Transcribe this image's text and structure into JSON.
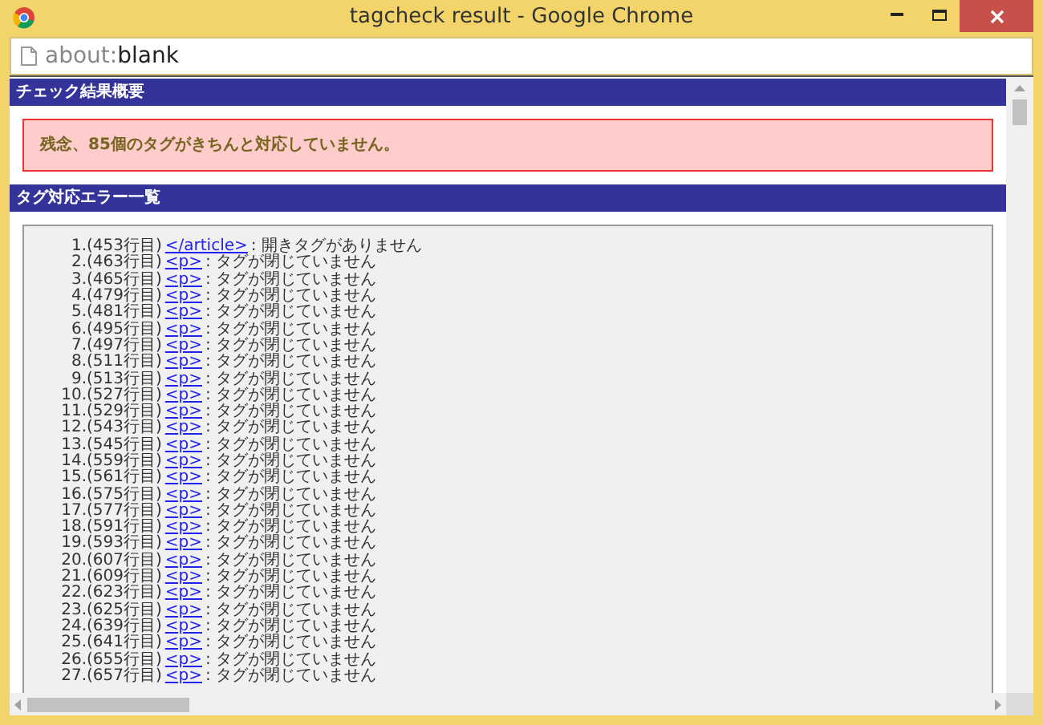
{
  "window": {
    "title": "tagcheck result - Google Chrome"
  },
  "address_bar": {
    "scheme": "about:",
    "path": "blank"
  },
  "summary": {
    "heading": "チェック結果概要",
    "message": "残念、85個のタグがきちんと対応していません。"
  },
  "errors": {
    "heading": "タグ対応エラー一覧",
    "rows": [
      {
        "number": "1.",
        "line": "(453行目)",
        "tag": "</article>",
        "message": ": 開きタグがありません"
      },
      {
        "number": "2.",
        "line": "(463行目)",
        "tag": "<p>",
        "message": ": タグが閉じていません"
      },
      {
        "number": "3.",
        "line": "(465行目)",
        "tag": "<p>",
        "message": ": タグが閉じていません"
      },
      {
        "number": "4.",
        "line": "(479行目)",
        "tag": "<p>",
        "message": ": タグが閉じていません"
      },
      {
        "number": "5.",
        "line": "(481行目)",
        "tag": "<p>",
        "message": ": タグが閉じていません"
      },
      {
        "number": "6.",
        "line": "(495行目)",
        "tag": "<p>",
        "message": ": タグが閉じていません"
      },
      {
        "number": "7.",
        "line": "(497行目)",
        "tag": "<p>",
        "message": ": タグが閉じていません"
      },
      {
        "number": "8.",
        "line": "(511行目)",
        "tag": "<p>",
        "message": ": タグが閉じていません"
      },
      {
        "number": "9.",
        "line": "(513行目)",
        "tag": "<p>",
        "message": ": タグが閉じていません"
      },
      {
        "number": "10.",
        "line": "(527行目)",
        "tag": "<p>",
        "message": ": タグが閉じていません"
      },
      {
        "number": "11.",
        "line": "(529行目)",
        "tag": "<p>",
        "message": ": タグが閉じていません"
      },
      {
        "number": "12.",
        "line": "(543行目)",
        "tag": "<p>",
        "message": ": タグが閉じていません"
      },
      {
        "number": "13.",
        "line": "(545行目)",
        "tag": "<p>",
        "message": ": タグが閉じていません"
      },
      {
        "number": "14.",
        "line": "(559行目)",
        "tag": "<p>",
        "message": ": タグが閉じていません"
      },
      {
        "number": "15.",
        "line": "(561行目)",
        "tag": "<p>",
        "message": ": タグが閉じていません"
      },
      {
        "number": "16.",
        "line": "(575行目)",
        "tag": "<p>",
        "message": ": タグが閉じていません"
      },
      {
        "number": "17.",
        "line": "(577行目)",
        "tag": "<p>",
        "message": ": タグが閉じていません"
      },
      {
        "number": "18.",
        "line": "(591行目)",
        "tag": "<p>",
        "message": ": タグが閉じていません"
      },
      {
        "number": "19.",
        "line": "(593行目)",
        "tag": "<p>",
        "message": ": タグが閉じていません"
      },
      {
        "number": "20.",
        "line": "(607行目)",
        "tag": "<p>",
        "message": ": タグが閉じていません"
      },
      {
        "number": "21.",
        "line": "(609行目)",
        "tag": "<p>",
        "message": ": タグが閉じていません"
      },
      {
        "number": "22.",
        "line": "(623行目)",
        "tag": "<p>",
        "message": ": タグが閉じていません"
      },
      {
        "number": "23.",
        "line": "(625行目)",
        "tag": "<p>",
        "message": ": タグが閉じていません"
      },
      {
        "number": "24.",
        "line": "(639行目)",
        "tag": "<p>",
        "message": ": タグが閉じていません"
      },
      {
        "number": "25.",
        "line": "(641行目)",
        "tag": "<p>",
        "message": ": タグが閉じていません"
      },
      {
        "number": "26.",
        "line": "(655行目)",
        "tag": "<p>",
        "message": ": タグが閉じていません"
      },
      {
        "number": "27.",
        "line": "(657行目)",
        "tag": "<p>",
        "message": ": タグが閉じていません"
      }
    ]
  }
}
